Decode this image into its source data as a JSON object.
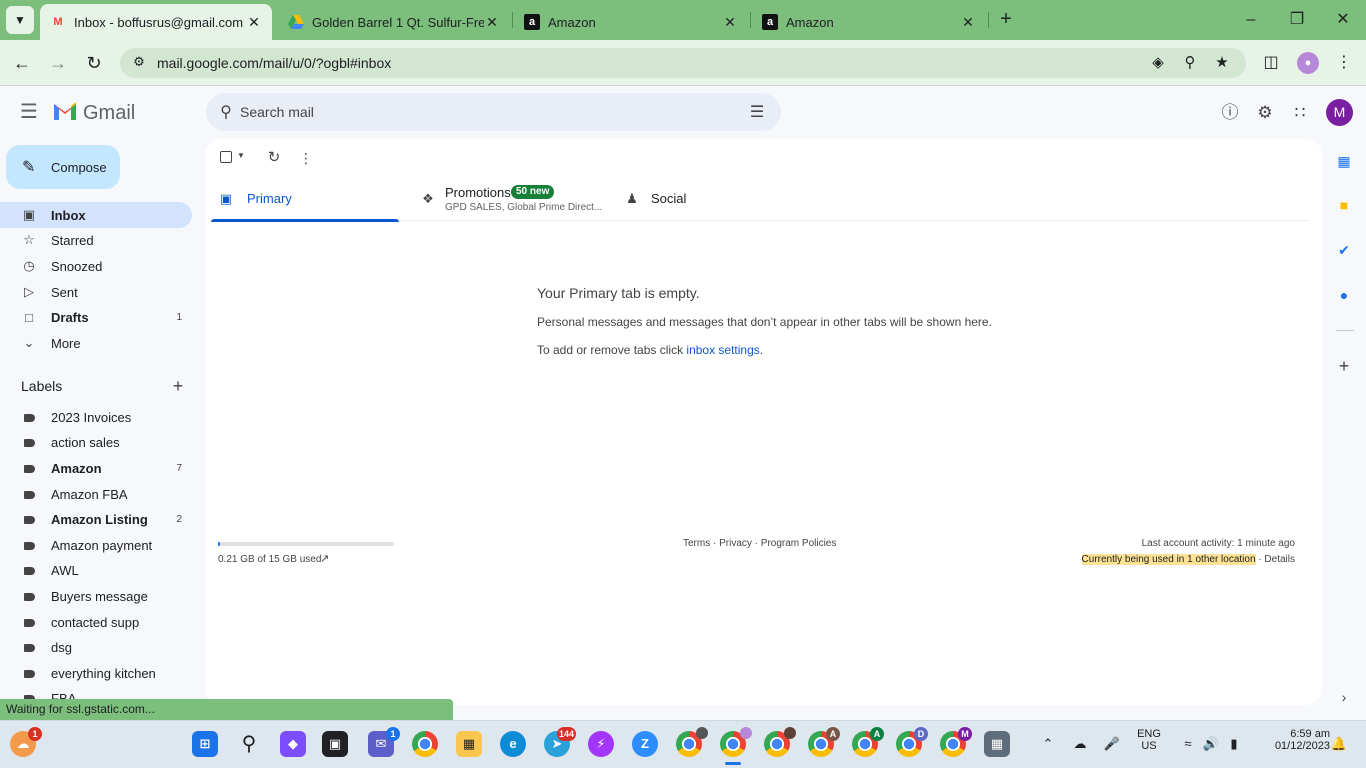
{
  "browser": {
    "tabs": [
      {
        "title": "Inbox - boffusrus@gmail.com -",
        "favicon": "gmail-icon"
      },
      {
        "title": "Golden Barrel 1 Qt. Sulfur-Free",
        "favicon": "drive-icon"
      },
      {
        "title": "Amazon",
        "favicon": "amazon-icon"
      },
      {
        "title": "Amazon",
        "favicon": "amazon-icon"
      }
    ],
    "url": "mail.google.com/mail/u/0/?ogbl#inbox",
    "status": "Waiting for ssl.gstatic.com..."
  },
  "gmail": {
    "brand": "Gmail",
    "search_placeholder": "Search mail",
    "avatar_initial": "M",
    "compose_label": "Compose",
    "nav": [
      {
        "label": "Inbox",
        "count": "",
        "icon": "inbox-icon"
      },
      {
        "label": "Starred",
        "count": "",
        "icon": "star-icon"
      },
      {
        "label": "Snoozed",
        "count": "",
        "icon": "clock-icon"
      },
      {
        "label": "Sent",
        "count": "",
        "icon": "send-icon"
      },
      {
        "label": "Drafts",
        "count": "1",
        "icon": "draft-icon"
      },
      {
        "label": "More",
        "count": "",
        "icon": "chevron-down-icon"
      }
    ],
    "labels_heading": "Labels",
    "labels": [
      {
        "label": "2023 Invoices",
        "count": ""
      },
      {
        "label": "action sales",
        "count": ""
      },
      {
        "label": "Amazon",
        "count": "7"
      },
      {
        "label": "Amazon FBA",
        "count": ""
      },
      {
        "label": "Amazon Listing",
        "count": "2"
      },
      {
        "label": "Amazon payment",
        "count": ""
      },
      {
        "label": "AWL",
        "count": ""
      },
      {
        "label": "Buyers message",
        "count": ""
      },
      {
        "label": "contacted supp",
        "count": ""
      },
      {
        "label": "dsg",
        "count": ""
      },
      {
        "label": "everything kitchen",
        "count": ""
      },
      {
        "label": "FBA",
        "count": ""
      }
    ],
    "tabs": {
      "primary": "Primary",
      "promotions": "Promotions",
      "promotions_badge": "50 new",
      "promotions_senders": "GPD SALES, Global Prime Direct...",
      "social": "Social"
    },
    "empty": {
      "title": "Your Primary tab is empty.",
      "line1": "Personal messages and messages that don’t appear in other tabs will be shown here.",
      "line2_prefix": "To add or remove tabs click ",
      "line2_link": "inbox settings",
      "line2_suffix": "."
    },
    "footer": {
      "storage_used_fraction": 0.014,
      "storage_text": "0.21 GB of 15 GB used",
      "links": "Terms · Privacy · Program Policies",
      "activity": "Last account activity: 1 minute ago",
      "other_location": "Currently being used in 1 other location",
      "details_sep": " · ",
      "details": "Details"
    }
  },
  "taskbar": {
    "badges": {
      "onedrive": "1",
      "teams": "1",
      "telegram": "144"
    },
    "language": "ENG",
    "region": "US",
    "time": "6:59 am",
    "date": "01/12/2023",
    "chrome_profiles": [
      "",
      "",
      "",
      "A",
      "A",
      "D",
      "M"
    ]
  },
  "colors": {
    "browser_frame": "#7cbf7c",
    "gmail_accent": "#0b57d0",
    "compose": "#c2e7ff",
    "promotions_badge": "#188038",
    "highlight": "#fde293"
  }
}
